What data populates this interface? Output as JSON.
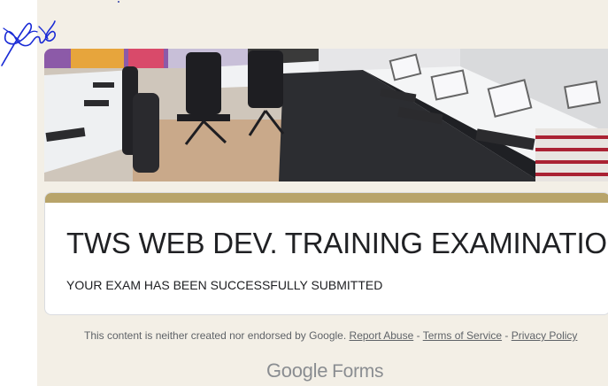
{
  "form": {
    "title": "TWS WEB DEV. TRAINING EXAMINATION",
    "confirmation_message": "YOUR EXAM HAS BEEN SUCCESSFULLY SUBMITTED"
  },
  "header_image": {
    "alt": "",
    "description_icon": "computer-lab-photo"
  },
  "footer": {
    "disclaimer": "This content is neither created nor endorsed by Google.",
    "report_abuse": "Report Abuse",
    "terms": "Terms of Service",
    "privacy": "Privacy Policy",
    "separator": " - "
  },
  "logo": {
    "brand": "Google",
    "product": "Forms"
  },
  "colors": {
    "accent": "#b8a46a",
    "page_background": "#f3efe6",
    "signature_ink": "#1a2bd6"
  }
}
